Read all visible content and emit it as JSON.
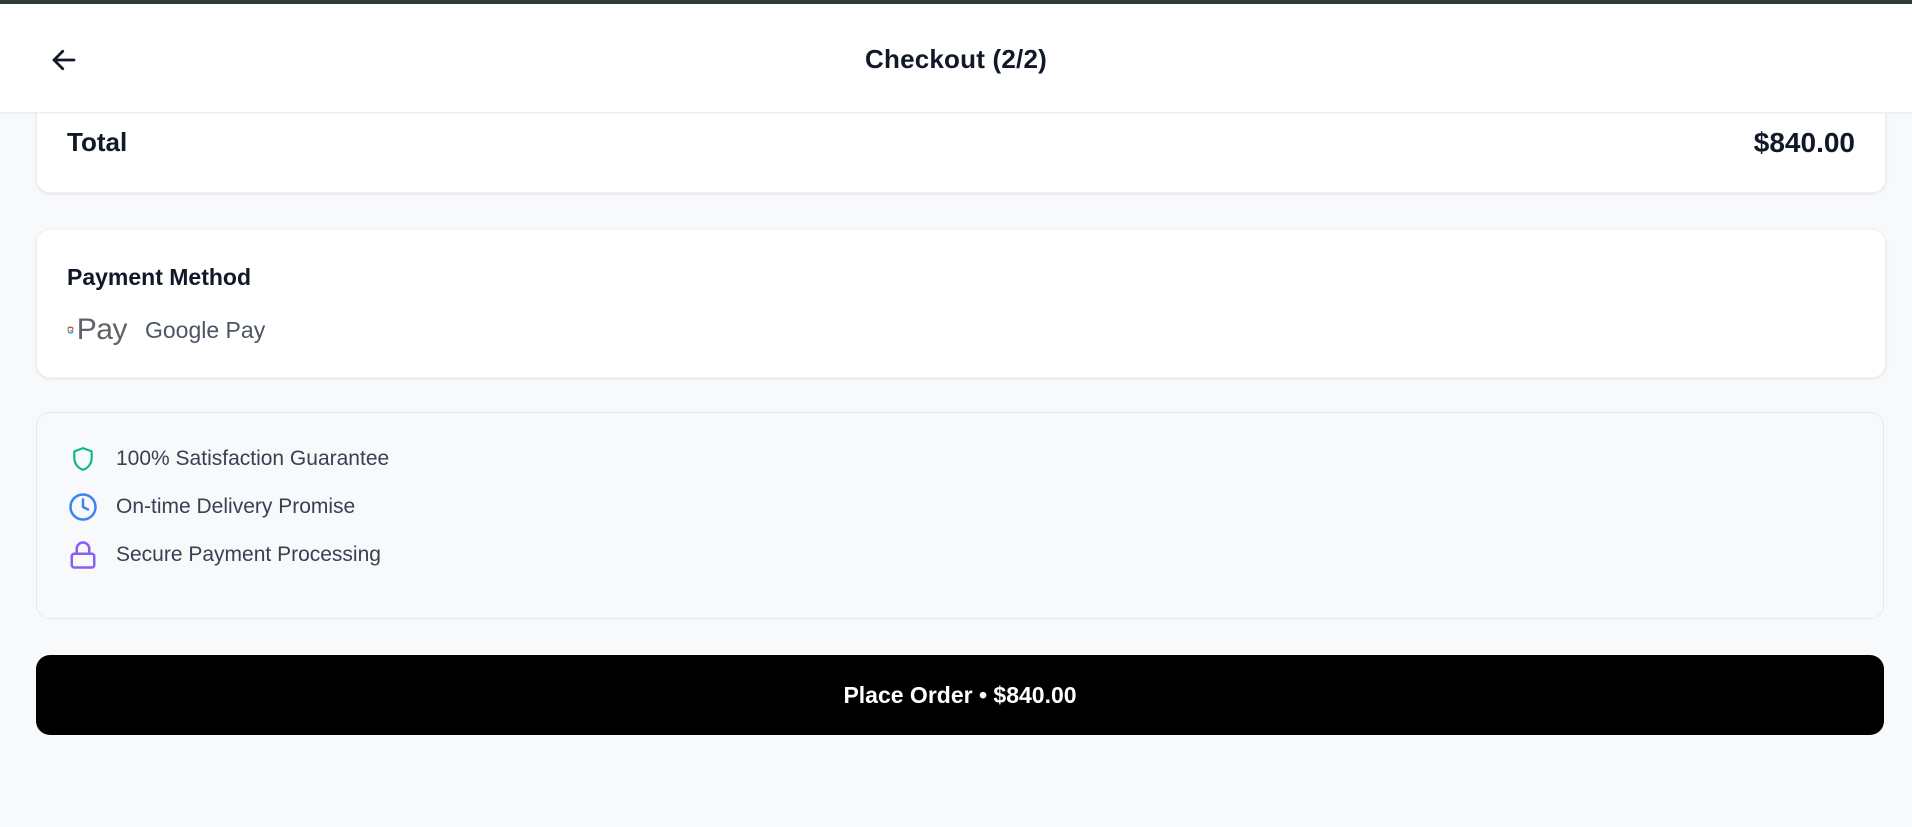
{
  "header": {
    "title": "Checkout (2/2)",
    "back_icon": "arrow-left-icon"
  },
  "summary": {
    "total_label": "Total",
    "total_value": "$840.00"
  },
  "payment": {
    "section_title": "Payment Method",
    "logo_icon": "google-pay-logo",
    "logo_text": "Pay",
    "method_name": "Google Pay"
  },
  "guarantees": {
    "items": [
      {
        "label": "100% Satisfaction Guarantee",
        "icon": "shield-icon",
        "color": "#10b981"
      },
      {
        "label": "On-time Delivery Promise",
        "icon": "clock-icon",
        "color": "#3b82f6"
      },
      {
        "label": "Secure Payment Processing",
        "icon": "lock-icon",
        "color": "#8b5cf6"
      }
    ]
  },
  "actions": {
    "place_order_label": "Place Order • $840.00"
  },
  "colors": {
    "primary_button": "#000000",
    "background": "#f8f9fb",
    "card": "#ffffff"
  }
}
